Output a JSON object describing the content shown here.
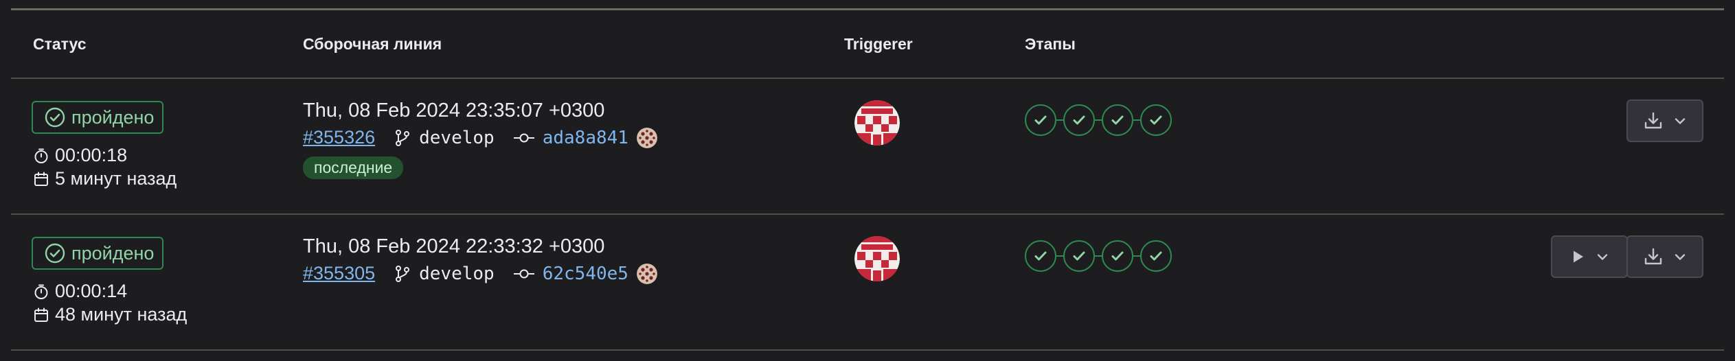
{
  "table": {
    "headers": {
      "status": "Статус",
      "pipeline": "Сборочная линия",
      "triggerer": "Triggerer",
      "stages": "Этапы"
    },
    "rows": [
      {
        "status_label": "пройдено",
        "duration": "00:00:18",
        "finished": "5 минут назад",
        "date": "Thu, 08 Feb 2024 23:35:07 +0300",
        "pipeline_id": "#355326",
        "branch": "develop",
        "commit": "ada8a841",
        "badge": "последние",
        "stages_count": 4
      },
      {
        "status_label": "пройдено",
        "duration": "00:00:14",
        "finished": "48 минут назад",
        "date": "Thu, 08 Feb 2024 22:33:32 +0300",
        "pipeline_id": "#355305",
        "branch": "develop",
        "commit": "62c540e5",
        "stages_count": 4
      }
    ]
  },
  "icons": {
    "status": "check-circle-icon",
    "duration": "timer-icon",
    "finished": "calendar-icon",
    "branch": "branch-icon",
    "commit": "commit-icon",
    "stage": "check-icon",
    "download": "download-icon",
    "play": "play-icon",
    "dropdown": "chevron-down-icon"
  },
  "colors": {
    "background": "#1d1d20",
    "success": "#2f8a51",
    "success_text": "#91d4a8",
    "link": "#7fb6ed",
    "badge_bg": "#24522f"
  }
}
